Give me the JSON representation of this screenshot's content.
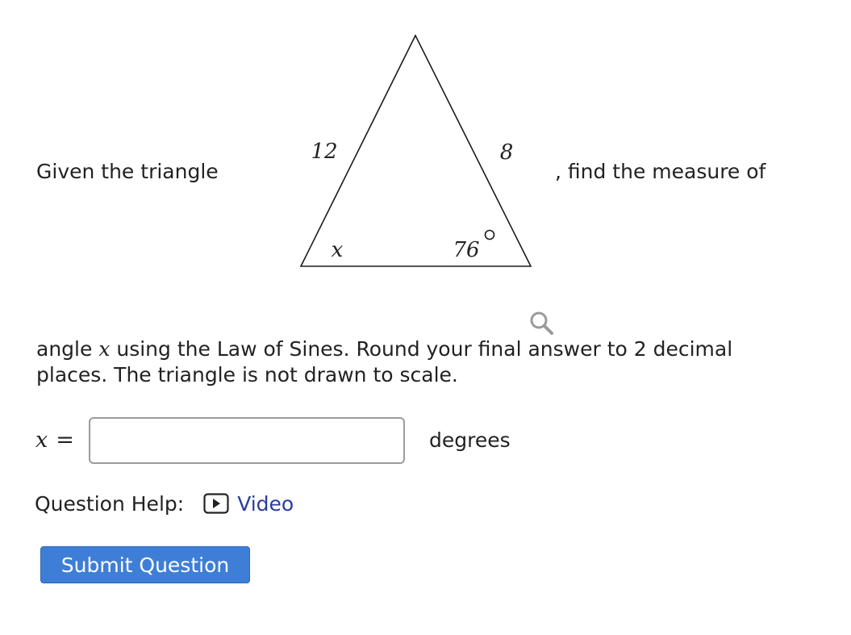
{
  "question": {
    "intro": "Given the triangle",
    "after_figure": ", find the measure of",
    "line2_prefix": "angle ",
    "line2_var": "x",
    "line2_suffix": " using the Law of Sines. Round your final answer to 2 decimal",
    "line3": "places. The triangle is not drawn to scale."
  },
  "figure": {
    "left_side_label": "12",
    "right_side_label": "8",
    "unknown_angle_label": "x",
    "known_angle_label": "76",
    "degree_symbol": "o"
  },
  "answer": {
    "variable": "x",
    "equals": "=",
    "input_value": "",
    "input_placeholder": "",
    "unit": "degrees"
  },
  "help": {
    "label": "Question Help:",
    "video_label": "Video"
  },
  "submit": {
    "label": "Submit Question",
    "color": "#3f7ed6"
  },
  "icons": {
    "zoom": "magnifier-icon",
    "video": "play-box-icon"
  }
}
